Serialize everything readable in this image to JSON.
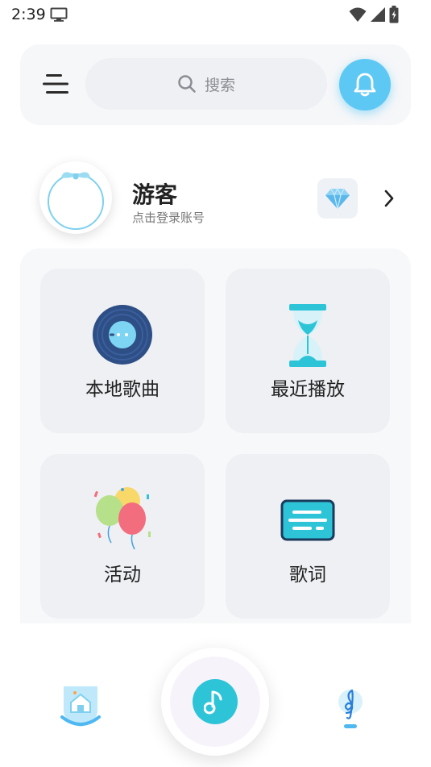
{
  "status_bar": {
    "time": "2:39"
  },
  "header": {
    "search_placeholder": "搜索"
  },
  "profile": {
    "name": "游客",
    "subtitle": "点击登录账号"
  },
  "grid": {
    "local_songs": "本地歌曲",
    "recent_play": "最近播放",
    "activities": "活动",
    "lyrics": "歌词"
  },
  "icons": {
    "menu": "menu-icon",
    "search": "search-icon",
    "bell": "bell-icon",
    "vip": "diamond-icon",
    "chevron": "chevron-right-icon",
    "home": "home-icon",
    "music": "music-note-icon",
    "treble": "treble-clef-icon"
  },
  "colors": {
    "accent_blue": "#5ec8f4",
    "teal": "#2ec4d8",
    "vinyl_navy": "#2e4e86"
  }
}
